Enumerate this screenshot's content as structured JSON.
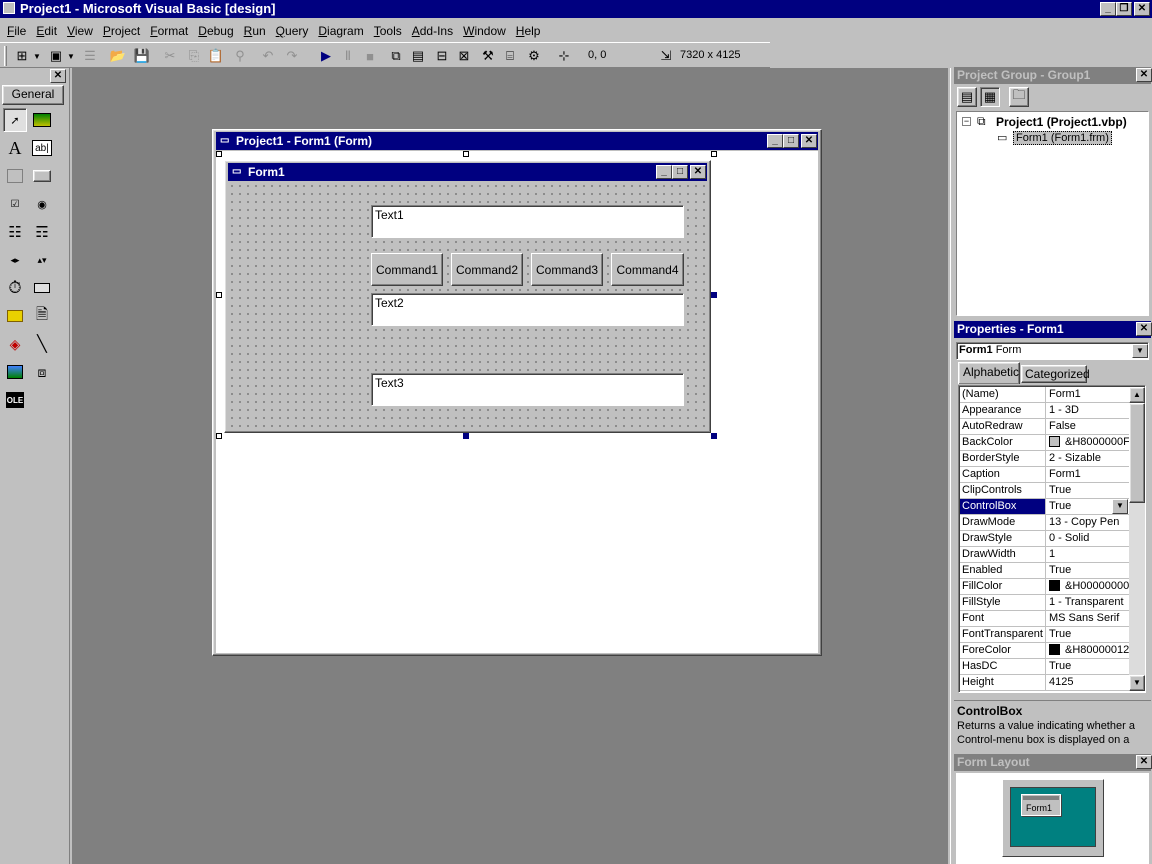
{
  "app": {
    "title": "Project1 - Microsoft Visual Basic [design]",
    "window_buttons": [
      "_",
      "❐",
      "✕"
    ]
  },
  "menu": [
    "File",
    "Edit",
    "View",
    "Project",
    "Format",
    "Debug",
    "Run",
    "Query",
    "Diagram",
    "Tools",
    "Add-Ins",
    "Window",
    "Help"
  ],
  "toolbar": {
    "position": "0, 0",
    "size": "7320 x 4125",
    "icons": [
      "add-project-icon",
      "add-form-icon",
      "menu-editor-icon",
      "open-project-icon",
      "save-project-icon",
      "cut-icon",
      "copy-icon",
      "paste-icon",
      "find-icon",
      "undo-icon",
      "redo-icon",
      "start-icon",
      "break-icon",
      "end-icon",
      "project-explorer-icon",
      "properties-window-icon",
      "form-layout-icon",
      "object-browser-icon",
      "toolbox-icon",
      "data-view-icon",
      "component-manager-icon"
    ]
  },
  "toolbox": {
    "tab_label": "General",
    "close": "✕",
    "tools": [
      "pointer-icon",
      "picturebox-icon",
      "label-icon",
      "textbox-icon",
      "frame-icon",
      "commandbutton-icon",
      "checkbox-icon",
      "optionbutton-icon",
      "combobox-icon",
      "listbox-icon",
      "hscrollbar-icon",
      "vscrollbar-icon",
      "timer-icon",
      "drivelistbox-icon",
      "dirlistbox-icon",
      "filelistbox-icon",
      "shape-icon",
      "line-icon",
      "image-icon",
      "data-icon",
      "ole-icon"
    ],
    "glyphs": {
      "textbox": "ab|",
      "ole": "OLE",
      "label": "A"
    }
  },
  "designer": {
    "window_title": "Project1 - Form1 (Form)",
    "form_caption": "Form1",
    "controls": {
      "text1": "Text1",
      "text2": "Text2",
      "text3": "Text3",
      "command1": "Command1",
      "command2": "Command2",
      "command3": "Command3",
      "command4": "Command4"
    }
  },
  "project_group": {
    "title": "Project Group - Group1",
    "project": "Project1 (Project1.vbp)",
    "form": "Form1 (Form1.frm)"
  },
  "properties": {
    "title": "Properties - Form1",
    "object_name": "Form1",
    "object_type": "Form",
    "tabs": [
      "Alphabetic",
      "Categorized"
    ],
    "rows": [
      {
        "name": "(Name)",
        "value": "Form1"
      },
      {
        "name": "Appearance",
        "value": "1 - 3D"
      },
      {
        "name": "AutoRedraw",
        "value": "False"
      },
      {
        "name": "BackColor",
        "value": "&H8000000F&",
        "swatch": "#c0c0c0"
      },
      {
        "name": "BorderStyle",
        "value": "2 - Sizable"
      },
      {
        "name": "Caption",
        "value": "Form1"
      },
      {
        "name": "ClipControls",
        "value": "True"
      },
      {
        "name": "ControlBox",
        "value": "True",
        "selected": true
      },
      {
        "name": "DrawMode",
        "value": "13 - Copy Pen"
      },
      {
        "name": "DrawStyle",
        "value": "0 - Solid"
      },
      {
        "name": "DrawWidth",
        "value": "1"
      },
      {
        "name": "Enabled",
        "value": "True"
      },
      {
        "name": "FillColor",
        "value": "&H00000000&",
        "swatch": "#000000"
      },
      {
        "name": "FillStyle",
        "value": "1 - Transparent"
      },
      {
        "name": "Font",
        "value": "MS Sans Serif"
      },
      {
        "name": "FontTransparent",
        "value": "True"
      },
      {
        "name": "ForeColor",
        "value": "&H80000012&",
        "swatch": "#000000"
      },
      {
        "name": "HasDC",
        "value": "True"
      },
      {
        "name": "Height",
        "value": "4125"
      }
    ],
    "description_title": "ControlBox",
    "description_text": "Returns a value indicating whether a Control-menu box is displayed on a"
  },
  "form_layout": {
    "title": "Form Layout",
    "form_label": "Form1"
  },
  "colors": {
    "active_title": "#000080",
    "inactive_title": "#808080",
    "face": "#c0c0c0",
    "workspace": "#808080",
    "monitor_screen": "#008080"
  }
}
